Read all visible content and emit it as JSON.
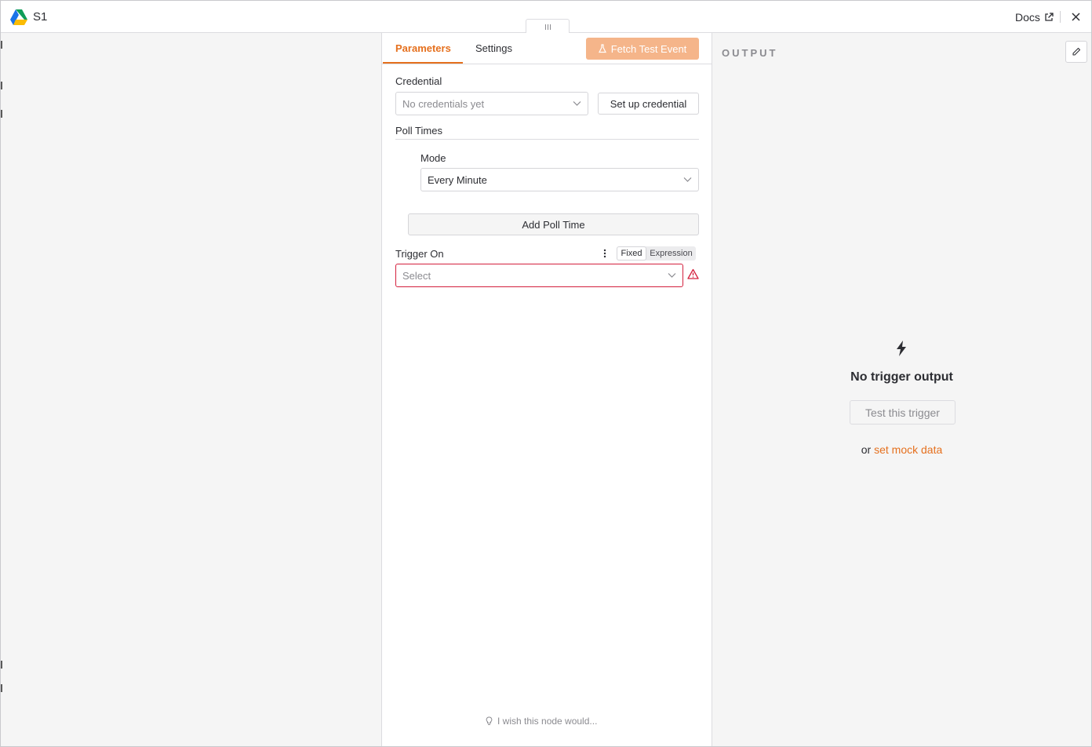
{
  "header": {
    "title": "S1",
    "docs_label": "Docs"
  },
  "tabs": [
    {
      "label": "Parameters",
      "active": true
    },
    {
      "label": "Settings",
      "active": false
    }
  ],
  "fetch_button": {
    "label": "Fetch Test Event"
  },
  "credential": {
    "label": "Credential",
    "placeholder": "No credentials yet",
    "setup_label": "Set up credential"
  },
  "poll_times": {
    "label": "Poll Times",
    "mode_label": "Mode",
    "mode_value": "Every Minute",
    "add_label": "Add Poll Time"
  },
  "trigger_on": {
    "label": "Trigger On",
    "fixed_label": "Fixed",
    "expression_label": "Expression",
    "placeholder": "Select"
  },
  "feedback": {
    "label": "I wish this node would..."
  },
  "output": {
    "title": "OUTPUT",
    "empty_title": "No trigger output",
    "test_label": "Test this trigger",
    "or_text": "or",
    "mock_link": "set mock data"
  },
  "colors": {
    "accent": "#e5701e",
    "accent_disabled": "#f5b58a",
    "error": "#d4203d"
  },
  "icons": [
    "google-drive-logo-icon",
    "external-link-icon",
    "close-icon",
    "flask-icon",
    "chevron-down-icon",
    "kebab-icon",
    "warning-icon",
    "lightbulb-icon",
    "pencil-icon",
    "bolt-icon"
  ]
}
